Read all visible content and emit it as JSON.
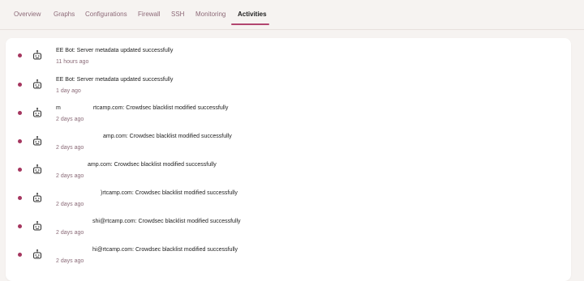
{
  "tabs": [
    {
      "label": "Overview",
      "active": false
    },
    {
      "label": "Graphs",
      "active": false
    },
    {
      "label": "Configurations",
      "active": false
    },
    {
      "label": "Firewall",
      "active": false
    },
    {
      "label": "SSH",
      "active": false
    },
    {
      "label": "Monitoring",
      "active": false
    },
    {
      "label": "Activities",
      "active": true
    }
  ],
  "colors": {
    "accent": "#b2456f",
    "dot": "#a5365f",
    "time_text": "#8b6b78",
    "panel_bg": "#ffffff",
    "page_bg": "#f6f3f1"
  },
  "activities": [
    {
      "icon": "bot-icon",
      "prefix": "",
      "title": "EE Bot: Server metadata updated successfully",
      "time": "11 hours ago"
    },
    {
      "icon": "bot-icon",
      "prefix": "",
      "title": "EE Bot: Server metadata updated successfully",
      "time": "1 day ago"
    },
    {
      "icon": "bot-icon",
      "prefix": "m",
      "title": "rtcamp.com: Crowdsec blacklist modified successfully",
      "time": "2 days ago"
    },
    {
      "icon": "bot-icon",
      "prefix": "",
      "title": "amp.com: Crowdsec blacklist modified successfully",
      "time": "2 days ago"
    },
    {
      "icon": "bot-icon",
      "prefix": "",
      "title": "amp.com: Crowdsec blacklist modified successfully",
      "time": "2 days ago"
    },
    {
      "icon": "bot-icon",
      "prefix": "",
      "title": ")rtcamp.com: Crowdsec blacklist modified successfully",
      "time": "2 days ago"
    },
    {
      "icon": "bot-icon",
      "prefix": "",
      "title": "shi@rtcamp.com: Crowdsec blacklist modified successfully",
      "time": "2 days ago"
    },
    {
      "icon": "bot-icon",
      "prefix": "",
      "title": "hi@rtcamp.com: Crowdsec blacklist modified successfully",
      "time": "2 days ago"
    }
  ]
}
